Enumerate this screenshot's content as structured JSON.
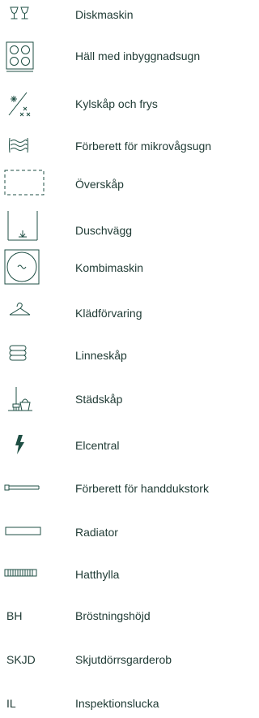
{
  "legend": {
    "items": [
      {
        "icon": "dishwasher-icon",
        "label": "Diskmaskin"
      },
      {
        "icon": "hob-with-extractor-icon",
        "label": "Häll med inbyggnadsugn"
      },
      {
        "icon": "fridge-freezer-icon",
        "label": "Kylskåp och frys"
      },
      {
        "icon": "microwave-icon",
        "label": "Förberett för mikrovågsugn"
      },
      {
        "icon": "wall-cabinet-icon",
        "label": "Överskåp"
      },
      {
        "icon": "shower-wall-icon",
        "label": "Duschvägg"
      },
      {
        "icon": "washer-dryer-icon",
        "label": "Kombimaskin"
      },
      {
        "icon": "clothes-hanger-icon",
        "label": "Klädförvaring"
      },
      {
        "icon": "linen-cabinet-icon",
        "label": "Linneskåp"
      },
      {
        "icon": "cleaning-cabinet-icon",
        "label": "Städskåp"
      },
      {
        "icon": "lightning-bolt-icon",
        "label": "Elcentral"
      },
      {
        "icon": "towel-dryer-icon",
        "label": "Förberett för handdukstork"
      },
      {
        "icon": "radiator-icon",
        "label": "Radiator"
      },
      {
        "icon": "hat-shelf-icon",
        "label": "Hatthylla"
      },
      {
        "abbr": "BH",
        "label": "Bröstningshöjd"
      },
      {
        "abbr": "SKJD",
        "label": "Skjutdörrsgarderob"
      },
      {
        "abbr": "IL",
        "label": "Inspektionslucka"
      }
    ]
  }
}
